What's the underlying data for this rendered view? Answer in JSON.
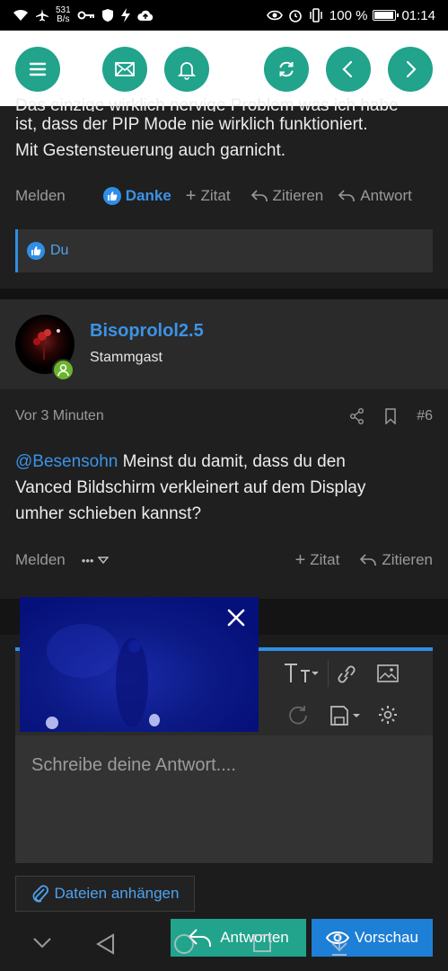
{
  "status_bar": {
    "net_speed_value": "531",
    "net_speed_unit": "B/s",
    "battery": "100 %",
    "battery_level": 1.0,
    "time": "01:14"
  },
  "toolbar": {
    "buttons": [
      "menu-icon",
      "mail-icon",
      "bell-icon",
      "refresh-icon",
      "back-icon",
      "forward-icon"
    ],
    "accent": "#21a38c"
  },
  "previous_post": {
    "text_top": "Das einzige wirklich nervige Problem was ich habe",
    "text_line2": "ist, dass der PIP Mode nie wirklich funktioniert.",
    "text_line3": "Mit Gestensteuerung auch garnicht.",
    "actions": {
      "report": "Melden",
      "thanks": "Danke",
      "quote": "Zitat",
      "cite": "Zitieren",
      "reply": "Antwort"
    },
    "likes_by": "Du"
  },
  "post": {
    "author": "Bisoprolol2.5",
    "rank": "Stammgast",
    "time": "Vor 3 Minuten",
    "number": "#6",
    "mention": "@Besensohn",
    "text_line1": " Meinst du damit, dass du den",
    "text_line2": "Vanced Bildschirm verkleinert auf dem Display",
    "text_line3": "umher schieben kannst?",
    "actions": {
      "report": "Melden",
      "more": "•••",
      "quote": "Zitat",
      "cite": "Zitieren"
    }
  },
  "editor": {
    "placeholder": "Schreibe deine Antwort....",
    "attach_label": "Dateien anhängen",
    "submit_label": "Antworten",
    "preview_label": "Vorschau"
  },
  "colors": {
    "link": "#3b93e6",
    "like": "#2f8fe6",
    "online": "#6bb52e",
    "preview_btn": "#1e7fd6"
  }
}
